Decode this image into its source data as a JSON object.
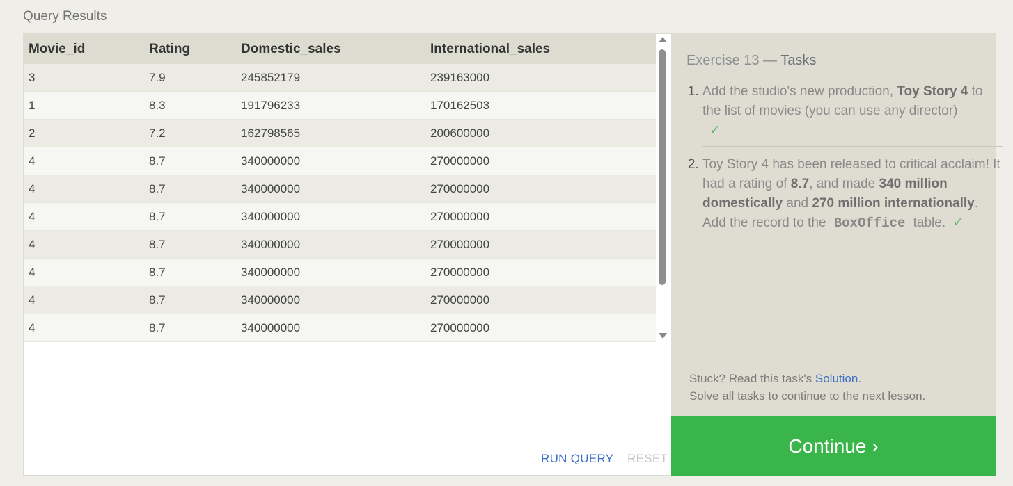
{
  "results": {
    "title": "Query Results",
    "columns": [
      "Movie_id",
      "Rating",
      "Domestic_sales",
      "International_sales"
    ],
    "rows": [
      [
        "3",
        "7.9",
        "245852179",
        "239163000"
      ],
      [
        "1",
        "8.3",
        "191796233",
        "170162503"
      ],
      [
        "2",
        "7.2",
        "162798565",
        "200600000"
      ],
      [
        "4",
        "8.7",
        "340000000",
        "270000000"
      ],
      [
        "4",
        "8.7",
        "340000000",
        "270000000"
      ],
      [
        "4",
        "8.7",
        "340000000",
        "270000000"
      ],
      [
        "4",
        "8.7",
        "340000000",
        "270000000"
      ],
      [
        "4",
        "8.7",
        "340000000",
        "270000000"
      ],
      [
        "4",
        "8.7",
        "340000000",
        "270000000"
      ],
      [
        "4",
        "8.7",
        "340000000",
        "270000000"
      ]
    ]
  },
  "editor": {
    "run_label": "RUN QUERY",
    "reset_label": "RESET"
  },
  "tasks": {
    "exercise": "Exercise 13",
    "separator": " — ",
    "tasks_word": "Tasks",
    "task1": {
      "pre": "Add the studio's new production, ",
      "highlight": "Toy Story 4",
      "post": " to the list of movies (you can use any director)",
      "check": "✓"
    },
    "task2": {
      "t1": "Toy Story 4 has been released to critical acclaim! It had a rating of ",
      "b1": "8.7",
      "t2": ", and made ",
      "b2": "340 million domestically",
      "t3": " and ",
      "b3": "270 million internationally",
      "t4": ". Add the record to the ",
      "code": "BoxOffice",
      "t5": " table.",
      "check": "✓"
    },
    "stuck_pre": "Stuck? Read this task's ",
    "solution_link": "Solution",
    "stuck_post": ".",
    "solve_all": "Solve all tasks to continue to the next lesson."
  },
  "continue_label": "Continue ›",
  "colors": {
    "accent_green": "#3ab54a",
    "link_blue": "#3a6fc4",
    "check_green": "#5cba6a"
  }
}
